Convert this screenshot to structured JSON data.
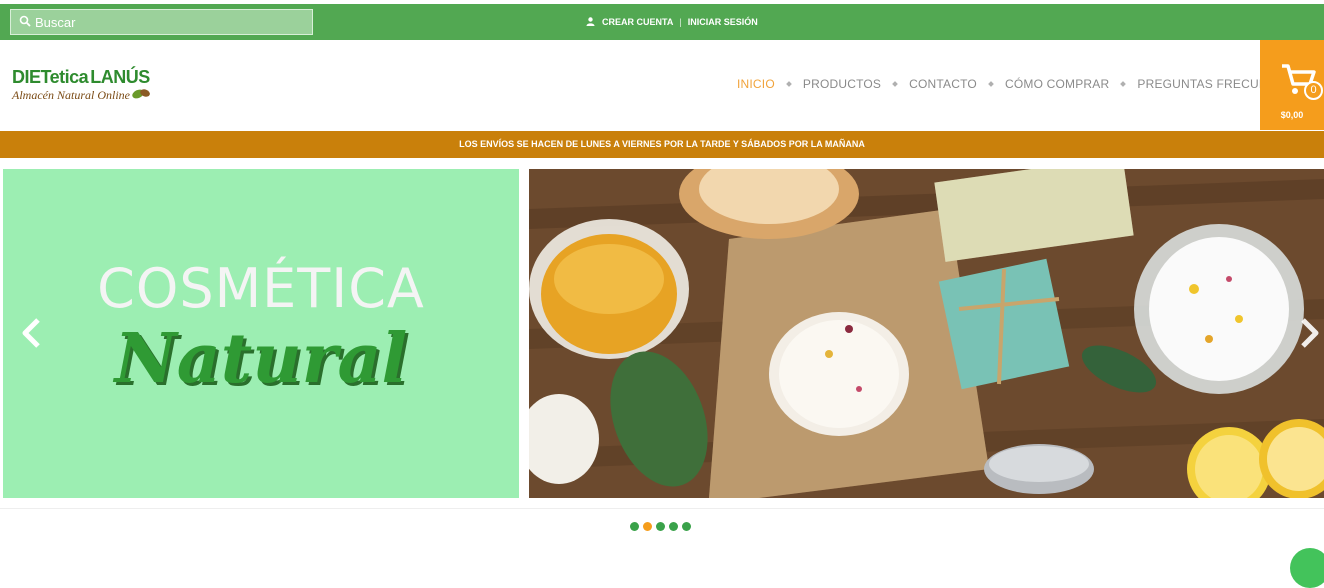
{
  "search": {
    "placeholder": "Buscar"
  },
  "account": {
    "create": "CREAR CUENTA",
    "separator": "|",
    "login": "INICIAR SESIÓN"
  },
  "logo": {
    "line1": "DIETetica",
    "line1b": "LANÚS",
    "line2": "Almacén Natural Online"
  },
  "nav": {
    "items": [
      {
        "label": "INICIO",
        "active": true
      },
      {
        "label": "PRODUCTOS",
        "active": false
      },
      {
        "label": "CONTACTO",
        "active": false
      },
      {
        "label": "CÓMO COMPRAR",
        "active": false
      },
      {
        "label": "PREGUNTAS FRECUENTES",
        "active": false
      }
    ]
  },
  "cart": {
    "count": "0",
    "total": "$0,00"
  },
  "notice": {
    "text": "LOS ENVÍOS SE HACEN DE LUNES A VIERNES POR LA TARDE Y SÁBADOS POR LA MAÑANA"
  },
  "slider": {
    "title": "COSMÉTICA",
    "subtitle": "Natural",
    "dots": [
      {
        "active": false
      },
      {
        "active": true
      },
      {
        "active": false
      },
      {
        "active": false
      },
      {
        "active": false
      }
    ]
  },
  "colors": {
    "topbar": "#52a852",
    "notice": "#c9800b",
    "cart": "#f59d1c",
    "active_nav": "#f1a33a",
    "slide_bg": "#9ceeb2"
  },
  "icons": {
    "search": "search-icon",
    "user": "user-icon",
    "cart": "cart-icon",
    "prev": "chevron-left-icon",
    "next": "chevron-right-icon"
  }
}
